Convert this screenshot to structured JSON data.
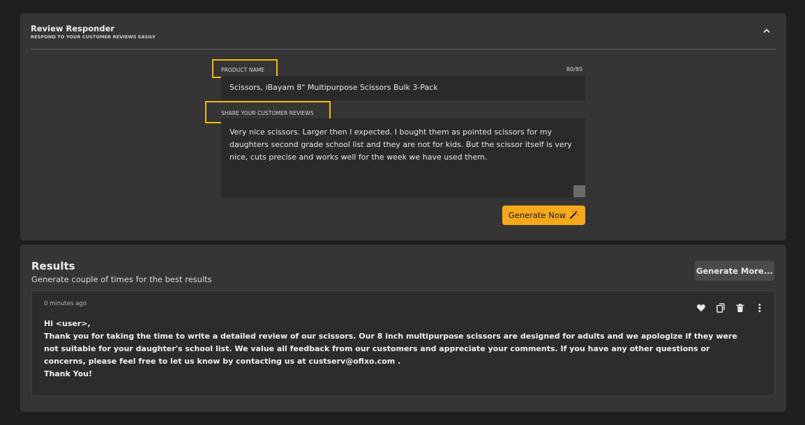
{
  "header": {
    "title": "Review Responder",
    "subtitle": "RESPOND TO YOUR CUSTOMER REVIEWS EASILY"
  },
  "form": {
    "product_label": "PRODUCT NAME",
    "product_counter": "80/80",
    "product_value": "Scissors, iBayam 8\" Multipurpose Scissors Bulk 3-Pack",
    "review_label": "SHARE YOUR CUSTOMER REVIEWS",
    "review_value": "Very nice scissors. Larger then I expected. I bought them as pointed scissors for my daughters second grade school list and they are not for kids. But the scissor itself is very nice, cuts precise and works well for the week we have used them.",
    "generate_label": "Generate Now"
  },
  "results": {
    "title": "Results",
    "subtitle": "Generate couple of times for the best results",
    "generate_more_label": "Generate More...",
    "items": [
      {
        "time": "0 minutes ago",
        "greeting": "Hi <user>,",
        "body": "Thank you for taking the time to write a detailed review of our scissors. Our 8 inch multipurpose scissors are designed for adults and we apologize if they were not suitable for your daughter's school list. We value all feedback from our customers and appreciate your comments. If you have any other questions or concerns, please feel free to let us know by contacting us at custserv@ofixo.com .",
        "signoff": "Thank You!"
      }
    ]
  },
  "colors": {
    "accent": "#f7a81b",
    "highlight": "#f5b90c",
    "panel": "#353535",
    "background": "#1f1f1f"
  },
  "icons": {
    "collapse": "chevron-up-icon",
    "generate": "magic-wand-icon",
    "favorite": "heart-icon",
    "copy": "copy-icon",
    "delete": "trash-icon",
    "more": "more-vertical-icon"
  }
}
